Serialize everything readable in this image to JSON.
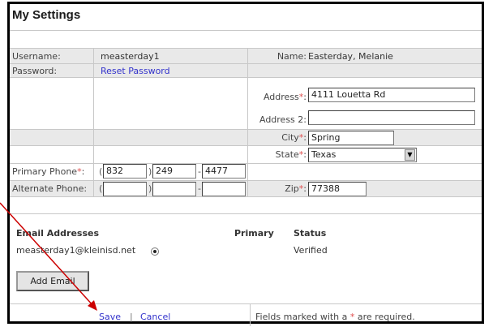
{
  "title": "My Settings",
  "account": {
    "username_label": "Username:",
    "username_value": "measterday1",
    "name_label": "Name:",
    "name_value": "Easterday, Melanie",
    "password_label": "Password:",
    "reset_password_link": "Reset Password"
  },
  "address": {
    "address_label": "Address",
    "address_value": "4111 Louetta Rd",
    "address2_label": "Address 2:",
    "address2_value": "",
    "city_label": "City",
    "city_value": "Spring",
    "state_label": "State",
    "state_value": "Texas",
    "zip_label": "Zip",
    "zip_value": "77388",
    "required_marker": "*",
    "colon": ":"
  },
  "phones": {
    "primary_label": "Primary Phone",
    "primary_area": "832",
    "primary_prefix": "249",
    "primary_line": "4477",
    "alternate_label": "Alternate Phone:",
    "alternate_area": "",
    "alternate_prefix": "",
    "alternate_line": "",
    "open_paren": "(",
    "close_paren": ")",
    "dash": "-"
  },
  "emails": {
    "header_address": "Email Addresses",
    "header_primary": "Primary",
    "header_status": "Status",
    "rows": [
      {
        "address": "measterday1@kleinisd.net",
        "status": "Verified"
      }
    ],
    "add_button": "Add Email"
  },
  "footer": {
    "save": "Save",
    "separator": "|",
    "cancel": "Cancel",
    "note_prefix": "Fields marked with a ",
    "note_star": "*",
    "note_suffix": " are required."
  },
  "colors": {
    "link": "#3333cc",
    "required": "#e05050",
    "annotation_arrow": "#cc0000",
    "band": "#e9e9e9"
  }
}
